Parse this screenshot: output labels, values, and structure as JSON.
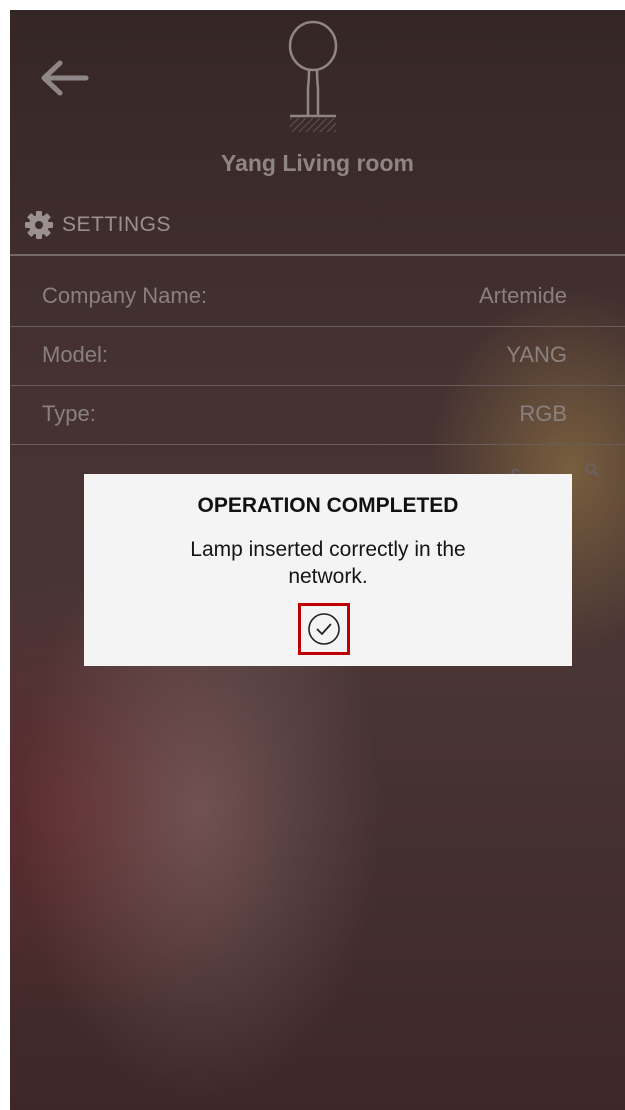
{
  "header": {
    "room_title": "Yang Living room"
  },
  "settings": {
    "section_label": "SETTINGS",
    "rows": [
      {
        "label": "Company Name:",
        "value": "Artemide"
      },
      {
        "label": "Model:",
        "value": "YANG"
      },
      {
        "label": "Type:",
        "value": "RGB"
      }
    ],
    "obscured_link_text": "s"
  },
  "dialog": {
    "title": "OPERATION COMPLETED",
    "message": "Lamp inserted correctly in the network."
  },
  "icons": {
    "back": "back-arrow-icon",
    "lamp": "lamp-icon",
    "settings": "gear-icon",
    "search": "search-icon",
    "confirm": "check-circle-icon"
  },
  "colors": {
    "dialog_background": "#f4f4f4",
    "confirm_highlight": "#c00000"
  }
}
